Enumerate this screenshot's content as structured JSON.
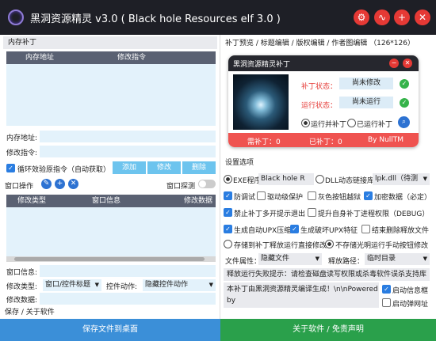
{
  "title": "黑洞资源精灵 v3.0 ( Black hole Resources elf 3.0 )",
  "title_buttons": [
    "gear-icon",
    "pulse-icon",
    "plus-icon",
    "close-icon"
  ],
  "left": {
    "memory_patch_label": "内存补丁",
    "table_headers": [
      "内存地址",
      "修改指令"
    ],
    "memory_address_label": "内存地址:",
    "modify_instruction_label": "修改指令:",
    "loop_verify_label": "循环效验原指令（自动获取）",
    "add_btn": "添加",
    "modify_btn": "修改",
    "delete_btn": "删除",
    "window_ops_label": "窗口操作",
    "window_detect_label": "窗口探测",
    "window_table_headers": [
      "修改类型",
      "窗口信息",
      "修改数据"
    ],
    "window_info_label": "窗口信息:",
    "modify_type_label": "修改类型:",
    "modify_type_value": "窗口/控件标题",
    "control_action_label": "控件动作:",
    "control_action_value": "隐藏控件动作",
    "modify_data_label": "修改数据:",
    "save_about_label": "保存 / 关于软件",
    "save_desktop_btn": "保存文件到桌面"
  },
  "right": {
    "preview_label": "补丁预览 / 标题编辑 / 版权编辑 / 作者图编辑 （126*126）",
    "preview": {
      "title": "黑洞资源精灵补丁",
      "patch_status_label": "补丁状态：",
      "patch_status_value": "尚未修改",
      "run_status_label": "运行状态：",
      "run_status_value": "尚未运行",
      "radio1": "运行并补丁",
      "radio2": "已运行补丁",
      "footer": [
        "需补丁：0",
        "已补丁：0",
        "By NullTM"
      ]
    },
    "settings_label": "设置选项",
    "exe_label": "EXE程序",
    "exe_value": "Black hole R",
    "dll_label": "DLL动态链接库",
    "dll_value": "lpk.dll（待测",
    "options_row1": [
      "防调试",
      "驱动级保护",
      "灰色按钮越狱",
      "加密数据（必定）"
    ],
    "options_row2": [
      "禁止补丁多开提示退出",
      "提升自身补丁进程权限（DEBUG）"
    ],
    "options_row3": [
      "生成自动UPX压缩",
      "生成破坏UPX特征",
      "结束删除释放文件"
    ],
    "radio_opt1": "存储到补丁释放运行直接修改",
    "radio_opt2": "不存储光明运行手动按钮修改",
    "file_attr_label": "文件属性：",
    "file_attr_value": "隐藏文件",
    "release_path_label": "释放路径：",
    "release_path_value": "临时目录",
    "fail_hint": "释放运行失败提示：请检查磁盘读写权限或杀毒软件误杀支持库",
    "patch_msg": "本补丁由黑洞资源精灵编译生成！\\n\\nPowered by",
    "startup_info_label": "启动信息框",
    "startup_web_label": "启动弹网址",
    "about_btn": "关于软件 / 免责声明"
  },
  "colors": {
    "titlebar": "#1e1f26",
    "accent_blue": "#3b8fd8",
    "accent_green": "#2aa04b",
    "red": "#e53935"
  }
}
